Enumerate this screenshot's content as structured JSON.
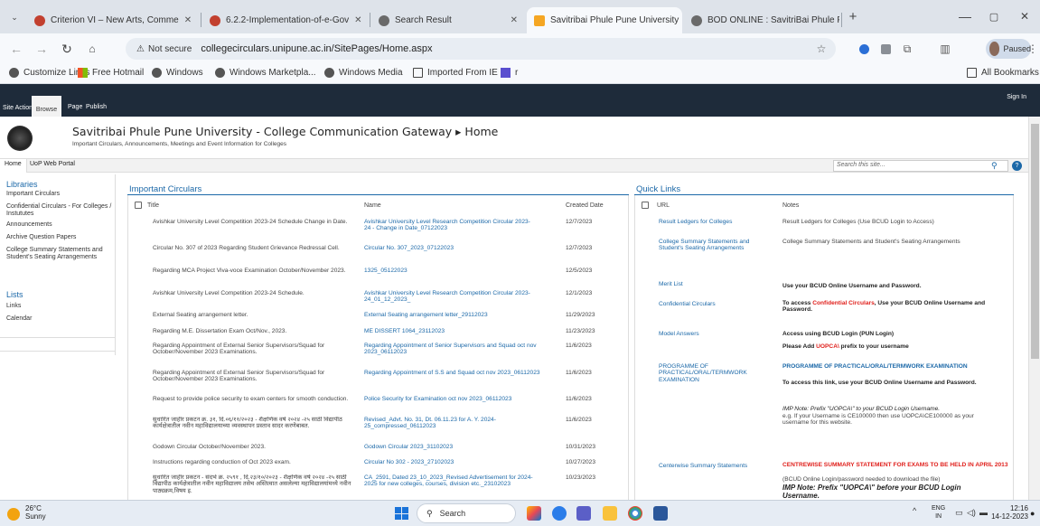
{
  "browser": {
    "tabs": [
      {
        "title": "Criterion VI – New Arts, Comme",
        "color": "#c2402f"
      },
      {
        "title": "6.2.2-Implementation-of-e-Gov",
        "color": "#c2402f"
      },
      {
        "title": "Search Result",
        "color": "#6a6a6a"
      },
      {
        "title": "Savitribai Phule Pune University",
        "color": "#f5a623"
      },
      {
        "title": "BOD ONLINE : SavitriBai Phule P",
        "color": "#6a6a6a"
      }
    ],
    "not_secure": "Not secure",
    "url": "collegecirculars.unipune.ac.in/SitePages/Home.aspx",
    "paused": "Paused",
    "bookmarks": [
      "Customize Links",
      "Free Hotmail",
      "Windows",
      "Windows Marketpla...",
      "Windows Media",
      "Imported From IE"
    ],
    "all_bookmarks": "All Bookmarks"
  },
  "ribbon": {
    "site_actions": "Site Actions ▾",
    "browse": "Browse",
    "page": "Page",
    "publish": "Publish",
    "sign_in": "Sign In"
  },
  "site": {
    "title": "Savitribai Phule Pune University - College Communication Gateway ▸ Home",
    "subtitle": "Important Circulars, Announcements, Meetings and Event Information for Colleges",
    "nav_home": "Home",
    "nav_portal": "UoP Web Portal",
    "search_placeholder": "Search this site...",
    "help": "?"
  },
  "leftnav": {
    "libraries": "Libraries",
    "items": [
      "Important Circulars",
      "Confidential Circulars - For Colleges / Instututes",
      "Announcements",
      "Archive Question Papers",
      "College Summary Statements and Student's Seating Arrangements"
    ],
    "lists": "Lists",
    "list_items": [
      "Links",
      "Calendar"
    ]
  },
  "circulars": {
    "heading": "Important Circulars",
    "col_title": "Title",
    "col_name": "Name",
    "col_date": "Created Date",
    "rows": [
      {
        "title": "Avishkar University Level Competition 2023-24 Schedule Change in Date.",
        "name": "Avishkar University Level Research Competition Circular 2023-24 - Change in Date_07122023",
        "date": "12/7/2023"
      },
      {
        "title": "Circular No. 307 of 2023 Regarding Student Grievance Redressal Cell.",
        "name": "Circular No. 307_2023_07122023",
        "date": "12/7/2023"
      },
      {
        "title": "Regarding MCA Project Viva-voce Examination October/November 2023.",
        "name": "1325_05122023",
        "date": "12/5/2023"
      },
      {
        "title": "Avishkar University Level Competition 2023-24 Schedule.",
        "name": "Avishkar University Level Research Competition Circular 2023-24_01_12_2023_",
        "date": "12/1/2023"
      },
      {
        "title": "External Seating arrangement letter.",
        "name": "External Seating arrangement letter_29112023",
        "date": "11/29/2023"
      },
      {
        "title": "Regarding M.E. Dissertation Exam Oct/Nov., 2023.",
        "name": "ME DISSERT 1064_23112023",
        "date": "11/23/2023"
      },
      {
        "title": "Regarding Appointment of External Senior Supervisors/Squad for October/November 2023 Examinations.",
        "name": "Regarding Appointment of Senior Supervisors and Squad oct nov 2023_06112023",
        "date": "11/6/2023"
      },
      {
        "title": "Regarding Appointment of External Senior Supervisors/Squad for October/November 2023 Examinations.",
        "name": "Regarding Appointment of S.S and Squad oct nov 2023_06112023",
        "date": "11/6/2023"
      },
      {
        "title": "Request to provide police security to exam centers for smooth conduction.",
        "name": "Police Security for Examination oct nov 2023_06112023",
        "date": "11/6/2023"
      },
      {
        "title": "सुधारित जाहीर प्रकटन क्र. ३१, दि.०६/११/२०२३ - शैक्षणिक वर्ष २०२४ -२५ साठी विद्यापीठ कार्यक्षेत्रातील नवीन महाविद्यालयाच्या व्यवस्थापन प्रस्ताव सादर करणेबाबत.",
        "name": "Revised_Advt. No. 31, Dt. 06.11.23 for A. Y. 2024-25_compressed_06112023",
        "date": "11/6/2023"
      },
      {
        "title": "Godown Circular October/November 2023.",
        "name": "Godown Circular 2023_31102023",
        "date": "10/31/2023"
      },
      {
        "title": "Instructions regarding conduction of Oct 2023 exam.",
        "name": "Circular No 302 - 2023_27102023",
        "date": "10/27/2023"
      },
      {
        "title": "सुधारित जाहीर प्रकटन - संदर्भ क्र. २५९१ , दि.२३/१०/२०२३ - शैक्षणिक वर्ष २०२४ -२५ साठी विद्यापीठ कार्यक्षेत्रातील नवीन महाविद्यालय तसेच अस्तित्वात असलेल्या महाविद्यालयांमध्ये नवीन पाठ्यक्रम,विषय इ.",
        "name": "CA_2591, Dated 23_10_2023_Revised Advertisement for 2024-2025 for new colleges, courses, division etc._23102023",
        "date": "10/23/2023"
      }
    ]
  },
  "quicklinks": {
    "heading": "Quick Links",
    "col_url": "URL",
    "col_notes": "Notes",
    "rows": [
      {
        "url": "Result Ledgers for Colleges",
        "notes": "Result Ledgers for Colleges (Use BCUD Login to Access)"
      },
      {
        "url": "College Summary Statements and Student's Seating Arrangements",
        "notes": " College Summary Statements and Student's Seating Arrangements"
      },
      {
        "url": "Merit List",
        "notes": "Use your BCUD Online Username and Password."
      },
      {
        "url": "Confidential Circulars",
        "notes_a": "To access ",
        "notes_b": "Confidential Circulars",
        "notes_c": ", Use your BCUD Online Username and Password."
      },
      {
        "url": "Model Answers",
        "notes": "Access using BCUD Login (PUN Login)",
        "notes2_a": "Please Add ",
        "notes2_b": "UOPCA\\",
        "notes2_c": " prefix to your username"
      },
      {
        "url": "PROGRAMME OF PRACTICAL/ORAL/TERMWORK EXAMINATION",
        "notes": "PROGRAMME OF PRACTICAL/ORAL/TERMWORK EXAMINATION",
        "notes2": "To access this link, use your BCUD Online Username and Password.",
        "notes3": "IMP Note: Prefix \"UOPCA\\\" to your BCUD Login Username.",
        "notes4": "e.g. If your Username is CE100000 then use UOPCA\\CE100000 as your username for this website."
      },
      {
        "url": "Centerwise Summary Statements",
        "notes": "CENTREWISE SUMMARY STATEMENT FOR EXAMS TO BE HELD IN APRIL 2013",
        "notes2": "(BCUD Online Login/password needed to download the file)",
        "notes3": "IMP Note: Prefix \"UOPCA\\\" before your BCUD Login Username."
      }
    ]
  },
  "taskbar": {
    "temp": "26°C",
    "weather": "Sunny",
    "search": "Search",
    "lang": "ENG",
    "region": "IN",
    "time": "12:16",
    "date": "14-12-2023"
  }
}
